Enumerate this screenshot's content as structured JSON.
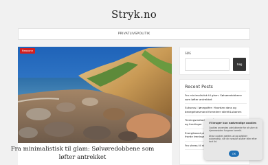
{
  "site": {
    "title": "Stryk.no"
  },
  "nav": {
    "items": [
      {
        "label": "PRIVATLIVSPOLITIK"
      }
    ]
  },
  "post": {
    "category": "Reasonn",
    "title": "Fra minimalistisk til glam: Sølvøredobbene som løfter antrekket"
  },
  "sidebar": {
    "search": {
      "label": "SØG",
      "placeholder": "",
      "button": "Søg"
    },
    "recent": {
      "heading": "Recent Posts",
      "items": [
        {
          "title": "Fra minimalistisk til glam: Sølvøredobbene som løfter antrekket"
        },
        {
          "title": "Sukseus i lønegolfer: Hvordan dans og bevegelsesmand fornedrer stiehtiLubanen"
        },
        {
          "title": "Treningsmetoder for å vanne diagnostikk til og fundinger"
        },
        {
          "title": "Energiboost på travle dager: Sånn bruker du frarde treningsmodel for..."
        },
        {
          "title": "Fra stress til styr..."
        }
      ]
    }
  },
  "cookie": {
    "title": "Vi bruger kun nødvendige cookies",
    "text1": "Cookies anvendes udelukkende for at sikre at hjemmesiden fungerer korrekt.",
    "text2": "Disse cookies sættes ud og opfølder automatisk, når din session slutter eller efter kort tid.",
    "button": "OK"
  },
  "colors": {
    "badge": "#d32020",
    "accent": "#1e6fb4",
    "dark_button": "#333333"
  },
  "icons": {
    "scene": "coastal-cliff-photo"
  }
}
